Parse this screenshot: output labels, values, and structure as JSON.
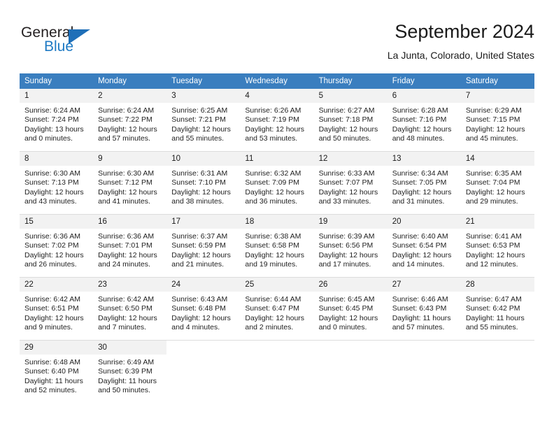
{
  "brand": {
    "name_part1": "General",
    "name_part2": "Blue"
  },
  "header": {
    "title": "September 2024",
    "subtitle": "La Junta, Colorado, United States"
  },
  "calendar": {
    "weekday_headers": [
      "Sunday",
      "Monday",
      "Tuesday",
      "Wednesday",
      "Thursday",
      "Friday",
      "Saturday"
    ],
    "colors": {
      "header_band": "#3a7ebf",
      "daynum_strip": "#f2f2f2",
      "brand_blue": "#1f7ac4",
      "grid_line": "#dcdcdc"
    },
    "weeks": [
      [
        {
          "day": "1",
          "sunrise": "Sunrise: 6:24 AM",
          "sunset": "Sunset: 7:24 PM",
          "daylight_line1": "Daylight: 13 hours",
          "daylight_line2": "and 0 minutes."
        },
        {
          "day": "2",
          "sunrise": "Sunrise: 6:24 AM",
          "sunset": "Sunset: 7:22 PM",
          "daylight_line1": "Daylight: 12 hours",
          "daylight_line2": "and 57 minutes."
        },
        {
          "day": "3",
          "sunrise": "Sunrise: 6:25 AM",
          "sunset": "Sunset: 7:21 PM",
          "daylight_line1": "Daylight: 12 hours",
          "daylight_line2": "and 55 minutes."
        },
        {
          "day": "4",
          "sunrise": "Sunrise: 6:26 AM",
          "sunset": "Sunset: 7:19 PM",
          "daylight_line1": "Daylight: 12 hours",
          "daylight_line2": "and 53 minutes."
        },
        {
          "day": "5",
          "sunrise": "Sunrise: 6:27 AM",
          "sunset": "Sunset: 7:18 PM",
          "daylight_line1": "Daylight: 12 hours",
          "daylight_line2": "and 50 minutes."
        },
        {
          "day": "6",
          "sunrise": "Sunrise: 6:28 AM",
          "sunset": "Sunset: 7:16 PM",
          "daylight_line1": "Daylight: 12 hours",
          "daylight_line2": "and 48 minutes."
        },
        {
          "day": "7",
          "sunrise": "Sunrise: 6:29 AM",
          "sunset": "Sunset: 7:15 PM",
          "daylight_line1": "Daylight: 12 hours",
          "daylight_line2": "and 45 minutes."
        }
      ],
      [
        {
          "day": "8",
          "sunrise": "Sunrise: 6:30 AM",
          "sunset": "Sunset: 7:13 PM",
          "daylight_line1": "Daylight: 12 hours",
          "daylight_line2": "and 43 minutes."
        },
        {
          "day": "9",
          "sunrise": "Sunrise: 6:30 AM",
          "sunset": "Sunset: 7:12 PM",
          "daylight_line1": "Daylight: 12 hours",
          "daylight_line2": "and 41 minutes."
        },
        {
          "day": "10",
          "sunrise": "Sunrise: 6:31 AM",
          "sunset": "Sunset: 7:10 PM",
          "daylight_line1": "Daylight: 12 hours",
          "daylight_line2": "and 38 minutes."
        },
        {
          "day": "11",
          "sunrise": "Sunrise: 6:32 AM",
          "sunset": "Sunset: 7:09 PM",
          "daylight_line1": "Daylight: 12 hours",
          "daylight_line2": "and 36 minutes."
        },
        {
          "day": "12",
          "sunrise": "Sunrise: 6:33 AM",
          "sunset": "Sunset: 7:07 PM",
          "daylight_line1": "Daylight: 12 hours",
          "daylight_line2": "and 33 minutes."
        },
        {
          "day": "13",
          "sunrise": "Sunrise: 6:34 AM",
          "sunset": "Sunset: 7:05 PM",
          "daylight_line1": "Daylight: 12 hours",
          "daylight_line2": "and 31 minutes."
        },
        {
          "day": "14",
          "sunrise": "Sunrise: 6:35 AM",
          "sunset": "Sunset: 7:04 PM",
          "daylight_line1": "Daylight: 12 hours",
          "daylight_line2": "and 29 minutes."
        }
      ],
      [
        {
          "day": "15",
          "sunrise": "Sunrise: 6:36 AM",
          "sunset": "Sunset: 7:02 PM",
          "daylight_line1": "Daylight: 12 hours",
          "daylight_line2": "and 26 minutes."
        },
        {
          "day": "16",
          "sunrise": "Sunrise: 6:36 AM",
          "sunset": "Sunset: 7:01 PM",
          "daylight_line1": "Daylight: 12 hours",
          "daylight_line2": "and 24 minutes."
        },
        {
          "day": "17",
          "sunrise": "Sunrise: 6:37 AM",
          "sunset": "Sunset: 6:59 PM",
          "daylight_line1": "Daylight: 12 hours",
          "daylight_line2": "and 21 minutes."
        },
        {
          "day": "18",
          "sunrise": "Sunrise: 6:38 AM",
          "sunset": "Sunset: 6:58 PM",
          "daylight_line1": "Daylight: 12 hours",
          "daylight_line2": "and 19 minutes."
        },
        {
          "day": "19",
          "sunrise": "Sunrise: 6:39 AM",
          "sunset": "Sunset: 6:56 PM",
          "daylight_line1": "Daylight: 12 hours",
          "daylight_line2": "and 17 minutes."
        },
        {
          "day": "20",
          "sunrise": "Sunrise: 6:40 AM",
          "sunset": "Sunset: 6:54 PM",
          "daylight_line1": "Daylight: 12 hours",
          "daylight_line2": "and 14 minutes."
        },
        {
          "day": "21",
          "sunrise": "Sunrise: 6:41 AM",
          "sunset": "Sunset: 6:53 PM",
          "daylight_line1": "Daylight: 12 hours",
          "daylight_line2": "and 12 minutes."
        }
      ],
      [
        {
          "day": "22",
          "sunrise": "Sunrise: 6:42 AM",
          "sunset": "Sunset: 6:51 PM",
          "daylight_line1": "Daylight: 12 hours",
          "daylight_line2": "and 9 minutes."
        },
        {
          "day": "23",
          "sunrise": "Sunrise: 6:42 AM",
          "sunset": "Sunset: 6:50 PM",
          "daylight_line1": "Daylight: 12 hours",
          "daylight_line2": "and 7 minutes."
        },
        {
          "day": "24",
          "sunrise": "Sunrise: 6:43 AM",
          "sunset": "Sunset: 6:48 PM",
          "daylight_line1": "Daylight: 12 hours",
          "daylight_line2": "and 4 minutes."
        },
        {
          "day": "25",
          "sunrise": "Sunrise: 6:44 AM",
          "sunset": "Sunset: 6:47 PM",
          "daylight_line1": "Daylight: 12 hours",
          "daylight_line2": "and 2 minutes."
        },
        {
          "day": "26",
          "sunrise": "Sunrise: 6:45 AM",
          "sunset": "Sunset: 6:45 PM",
          "daylight_line1": "Daylight: 12 hours",
          "daylight_line2": "and 0 minutes."
        },
        {
          "day": "27",
          "sunrise": "Sunrise: 6:46 AM",
          "sunset": "Sunset: 6:43 PM",
          "daylight_line1": "Daylight: 11 hours",
          "daylight_line2": "and 57 minutes."
        },
        {
          "day": "28",
          "sunrise": "Sunrise: 6:47 AM",
          "sunset": "Sunset: 6:42 PM",
          "daylight_line1": "Daylight: 11 hours",
          "daylight_line2": "and 55 minutes."
        }
      ],
      [
        {
          "day": "29",
          "sunrise": "Sunrise: 6:48 AM",
          "sunset": "Sunset: 6:40 PM",
          "daylight_line1": "Daylight: 11 hours",
          "daylight_line2": "and 52 minutes."
        },
        {
          "day": "30",
          "sunrise": "Sunrise: 6:49 AM",
          "sunset": "Sunset: 6:39 PM",
          "daylight_line1": "Daylight: 11 hours",
          "daylight_line2": "and 50 minutes."
        },
        {
          "day": "",
          "sunrise": "",
          "sunset": "",
          "daylight_line1": "",
          "daylight_line2": ""
        },
        {
          "day": "",
          "sunrise": "",
          "sunset": "",
          "daylight_line1": "",
          "daylight_line2": ""
        },
        {
          "day": "",
          "sunrise": "",
          "sunset": "",
          "daylight_line1": "",
          "daylight_line2": ""
        },
        {
          "day": "",
          "sunrise": "",
          "sunset": "",
          "daylight_line1": "",
          "daylight_line2": ""
        },
        {
          "day": "",
          "sunrise": "",
          "sunset": "",
          "daylight_line1": "",
          "daylight_line2": ""
        }
      ]
    ]
  }
}
